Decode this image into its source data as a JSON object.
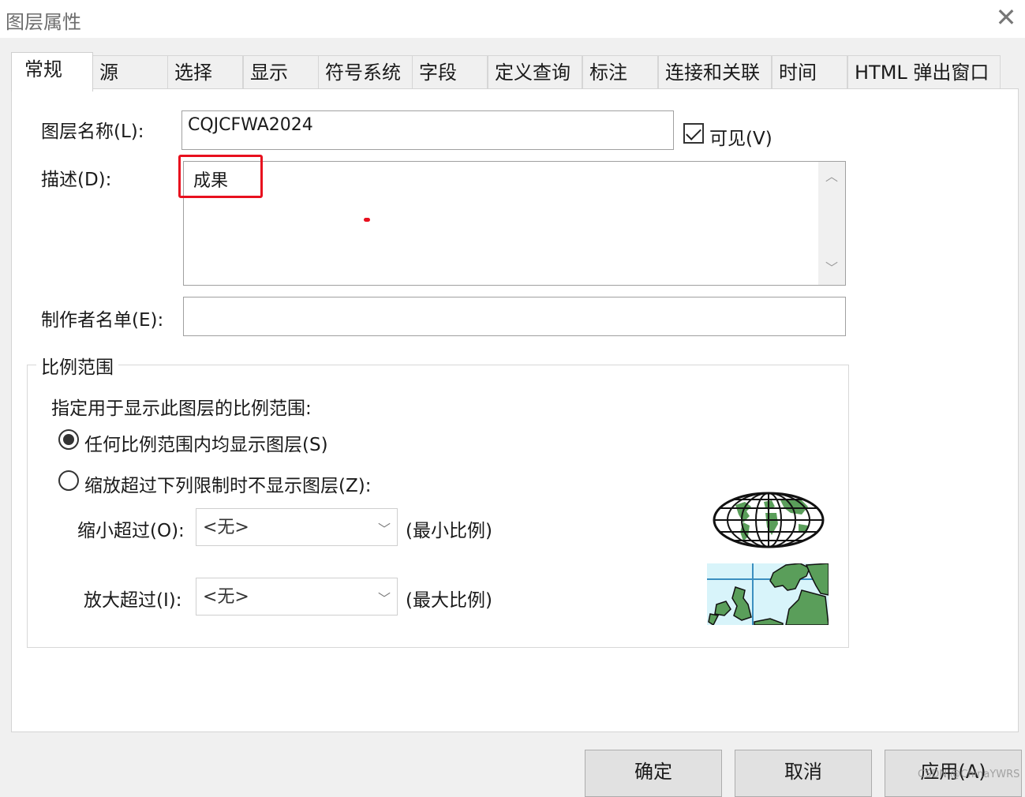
{
  "window": {
    "title": "图层属性"
  },
  "tabs": [
    {
      "label": "常规",
      "active": true
    },
    {
      "label": "源"
    },
    {
      "label": "选择"
    },
    {
      "label": "显示"
    },
    {
      "label": "符号系统"
    },
    {
      "label": "字段"
    },
    {
      "label": "定义查询"
    },
    {
      "label": "标注"
    },
    {
      "label": "连接和关联"
    },
    {
      "label": "时间"
    },
    {
      "label": "HTML 弹出窗口"
    }
  ],
  "general": {
    "layer_name_label": "图层名称(L):",
    "layer_name_value": "CQJCFWA2024",
    "visible_label": "可见(V)",
    "visible_checked": true,
    "description_label": "描述(D):",
    "description_value": "成果",
    "credits_label": "制作者名单(E):",
    "credits_value": ""
  },
  "scale_range": {
    "group_title": "比例范围",
    "instruction": "指定用于显示此图层的比例范围:",
    "option_any": "任何比例范围内均显示图层(S)",
    "option_limit": "缩放超过下列限制时不显示图层(Z):",
    "selected_option": "any",
    "min_label": "缩小超过(O):",
    "min_value": "<无>",
    "min_hint": "(最小比例)",
    "max_label": "放大超过(I):",
    "max_value": "<无>",
    "max_hint": "(最大比例)"
  },
  "buttons": {
    "ok": "确定",
    "cancel": "取消",
    "apply": "应用(A)"
  },
  "watermark": "CSDN @ChinaYWRS",
  "colors": {
    "annotation_red": "#e8101e",
    "map_land": "#5a9e5a",
    "map_water": "#d8f4fa"
  }
}
